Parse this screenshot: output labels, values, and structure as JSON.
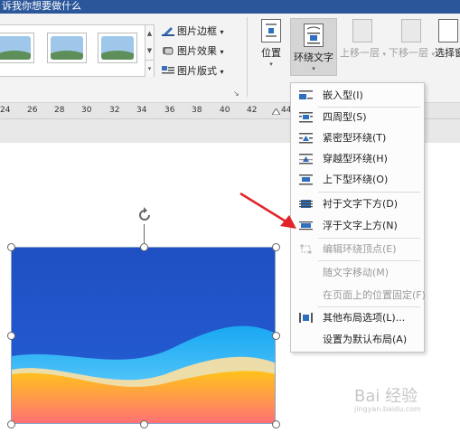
{
  "titlebar": {
    "text": "诉我你想要做什么"
  },
  "ribbon": {
    "picture_styles": {
      "commands": [
        {
          "label": "图片边框",
          "icon": "picture-border-icon"
        },
        {
          "label": "图片效果",
          "icon": "picture-effects-icon"
        },
        {
          "label": "图片版式",
          "icon": "picture-layout-icon"
        }
      ],
      "caret": "▾",
      "launcher": "↘"
    },
    "arrange": {
      "position_label": "位置",
      "wrap_text_label": "环绕文字",
      "bring_forward_label": "上移一层",
      "send_backward_label": "下移一层",
      "selection_pane_label": "选择窗",
      "caret": "▾"
    }
  },
  "ruler": {
    "numbers": [
      "24",
      "26",
      "28",
      "30",
      "32",
      "34",
      "36",
      "38",
      "40",
      "42",
      "44"
    ]
  },
  "wrap_menu": {
    "items": [
      {
        "label": "嵌入型(I)",
        "icon": "inline-wrap-icon",
        "enabled": true
      },
      {
        "label": "四周型(S)",
        "icon": "square-wrap-icon",
        "enabled": true
      },
      {
        "label": "紧密型环绕(T)",
        "icon": "tight-wrap-icon",
        "enabled": true
      },
      {
        "label": "穿越型环绕(H)",
        "icon": "through-wrap-icon",
        "enabled": true
      },
      {
        "label": "上下型环绕(O)",
        "icon": "top-bottom-wrap-icon",
        "enabled": true
      },
      {
        "label": "衬于文字下方(D)",
        "icon": "behind-text-icon",
        "enabled": true
      },
      {
        "label": "浮于文字上方(N)",
        "icon": "in-front-of-text-icon",
        "enabled": true
      },
      {
        "label": "编辑环绕顶点(E)",
        "icon": "edit-wrap-points-icon",
        "enabled": false
      },
      {
        "label": "随文字移动(M)",
        "icon": "",
        "enabled": false
      },
      {
        "label": "在页面上的位置固定(F)",
        "icon": "",
        "enabled": false
      },
      {
        "label": "其他布局选项(L)...",
        "icon": "more-layout-options-icon",
        "enabled": true
      },
      {
        "label": "设置为默认布局(A)",
        "icon": "",
        "enabled": true
      }
    ]
  },
  "watermark": {
    "text": "Bai 经验",
    "sub": "jingyan.baidu.com"
  },
  "colors": {
    "title_bar": "#2b579a",
    "annotation_arrow": "#e0242a",
    "menu_icon_blue": "#2f6fc0"
  }
}
